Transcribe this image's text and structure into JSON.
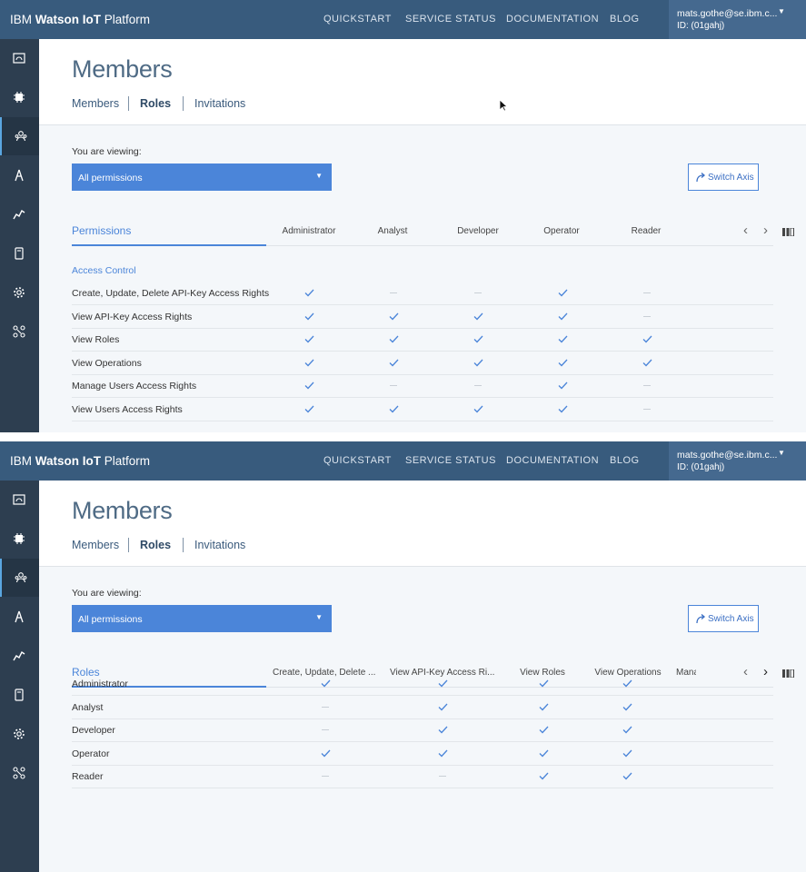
{
  "app": {
    "brand_prefix": "IBM ",
    "brand_bold": "Watson IoT",
    "brand_suffix": " Platform",
    "nav": [
      "QUICKSTART",
      "SERVICE STATUS",
      "DOCUMENTATION",
      "BLOG"
    ],
    "account": {
      "email": "mats.gothe@se.ibm.c...",
      "id": "ID: (01gahj)"
    }
  },
  "sidebar": {
    "items": [
      "dashboard-icon",
      "devices-icon",
      "members-icon",
      "rules-icon",
      "usage-icon",
      "extensions-icon",
      "settings-icon",
      "apps-icon"
    ],
    "active_index": 2
  },
  "colors": {
    "accent": "#4b85d9",
    "topbar": "#385b7d",
    "sidebar": "#2d3e50",
    "check": "#4b85d9"
  },
  "page": {
    "title": "Members",
    "subtabs": [
      "Members",
      "Roles",
      "Invitations"
    ],
    "active_subtab": "Roles",
    "viewing_label": "You are viewing:",
    "dropdown_value": "All permissions",
    "switch_axis_label": "Switch Axis"
  },
  "view1": {
    "first_column": "Permissions",
    "columns": [
      "Administrator",
      "Analyst",
      "Developer",
      "Operator",
      "Reader"
    ],
    "section": "Access Control",
    "rows": [
      {
        "label": "Create, Update, Delete API-Key Access Rights",
        "values": [
          true,
          false,
          false,
          true,
          false
        ]
      },
      {
        "label": "View API-Key Access Rights",
        "values": [
          true,
          true,
          true,
          true,
          false
        ]
      },
      {
        "label": "View Roles",
        "values": [
          true,
          true,
          true,
          true,
          true
        ]
      },
      {
        "label": "View Operations",
        "values": [
          true,
          true,
          true,
          true,
          true
        ]
      },
      {
        "label": "Manage Users Access Rights",
        "values": [
          true,
          false,
          false,
          true,
          false
        ]
      },
      {
        "label": "View Users Access Rights",
        "values": [
          true,
          true,
          true,
          true,
          false
        ]
      }
    ]
  },
  "view2": {
    "first_column": "Roles",
    "columns": [
      "Create, Update, Delete API-Key Access Rights",
      "View API-Key Access Rights",
      "View Roles",
      "View Operations",
      "Manage Users Access Rights"
    ],
    "columns_display": [
      "Create, Update, Delete ...",
      "View API-Key Access Ri...",
      "View Roles",
      "View Operations",
      "Mana"
    ],
    "rows": [
      {
        "label": "Administrator",
        "values": [
          true,
          true,
          true,
          true
        ]
      },
      {
        "label": "Analyst",
        "values": [
          false,
          true,
          true,
          true
        ]
      },
      {
        "label": "Developer",
        "values": [
          false,
          true,
          true,
          true
        ]
      },
      {
        "label": "Operator",
        "values": [
          true,
          true,
          true,
          true
        ]
      },
      {
        "label": "Reader",
        "values": [
          false,
          false,
          true,
          true
        ]
      }
    ]
  }
}
